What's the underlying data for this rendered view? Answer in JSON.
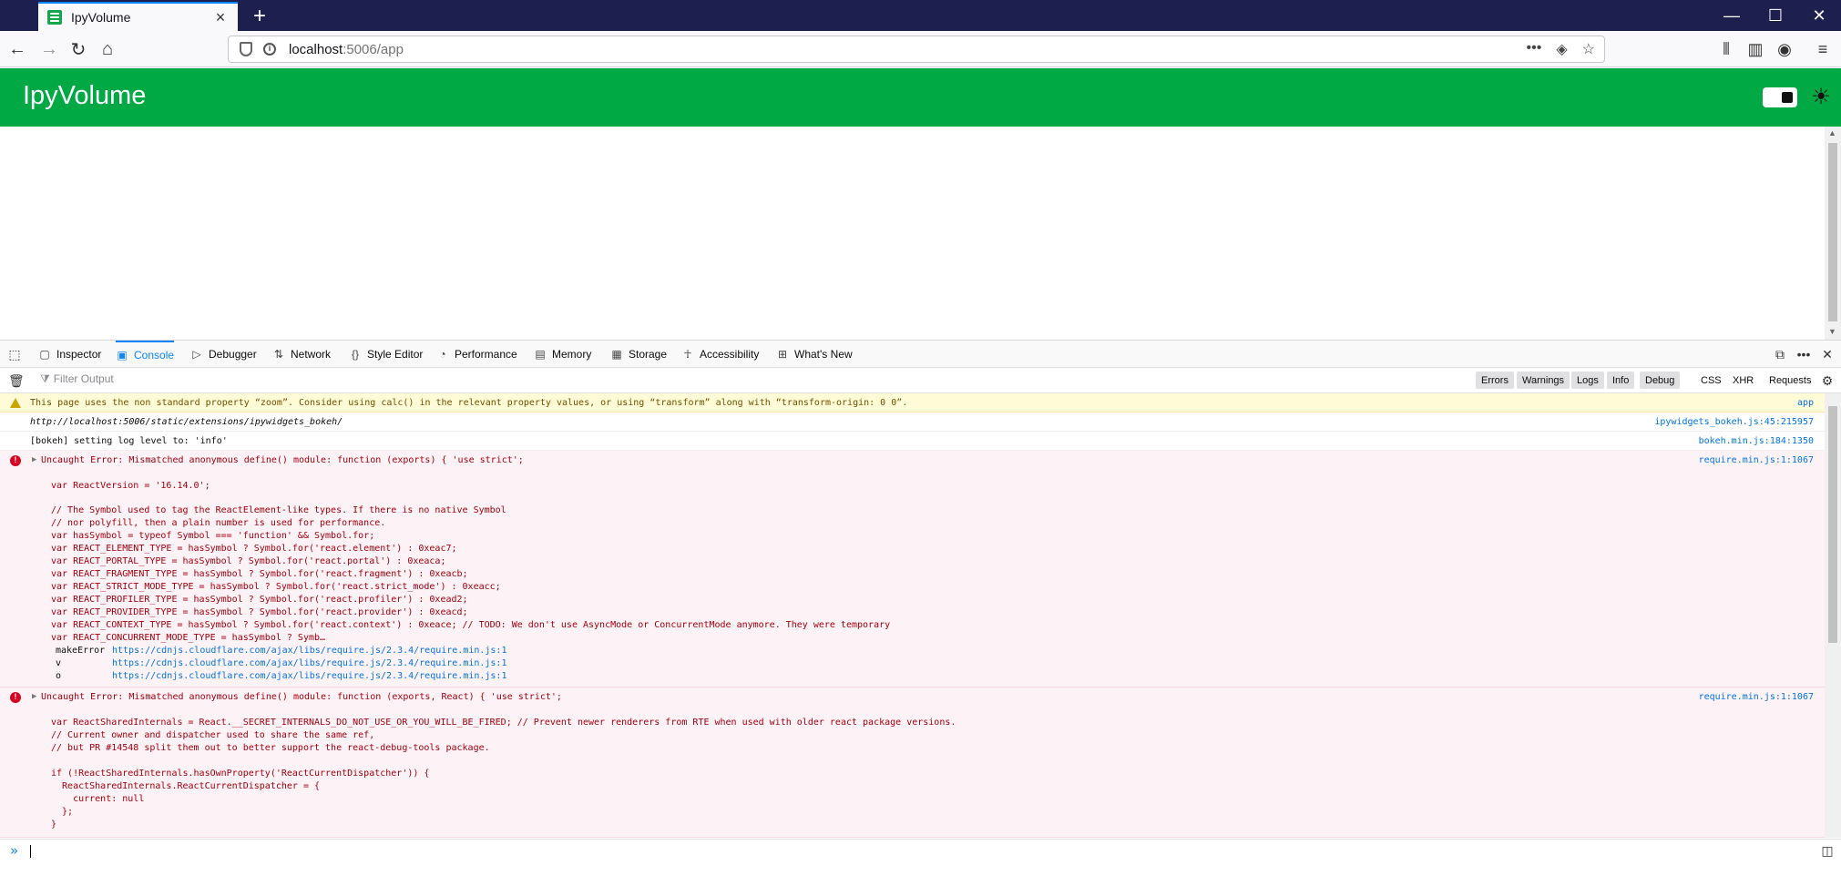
{
  "browser": {
    "tab_title": "IpyVolume",
    "url_host": "localhost",
    "url_path": ":5006/app"
  },
  "app": {
    "title": "IpyVolume"
  },
  "devtools": {
    "tabs": [
      "Inspector",
      "Console",
      "Debugger",
      "Network",
      "Style Editor",
      "Performance",
      "Memory",
      "Storage",
      "Accessibility",
      "What's New"
    ],
    "active_tab": "Console",
    "filter_placeholder": "Filter Output",
    "filters": [
      "Errors",
      "Warnings",
      "Logs",
      "Info",
      "Debug",
      "CSS",
      "XHR",
      "Requests"
    ]
  },
  "console": {
    "warning": {
      "text": "This page uses the non standard property “zoom”. Consider using calc() in the relevant property values, or using “transform” along with “transform-origin: 0 0”.",
      "source": "app"
    },
    "log1": {
      "text": "http://localhost:5006/static/extensions/ipywidgets_bokeh/",
      "source": "ipywidgets_bokeh.js:45:215957"
    },
    "log2": {
      "text": "[bokeh] setting log level to: 'info'",
      "source": "bokeh.min.js:184:1350"
    },
    "error1": {
      "head": "Uncaught Error: Mismatched anonymous define() module: function (exports) { 'use strict';",
      "source": "require.min.js:1:1067",
      "lines": [
        "var ReactVersion = '16.14.0';",
        "",
        "// The Symbol used to tag the ReactElement-like types. If there is no native Symbol",
        "// nor polyfill, then a plain number is used for performance.",
        "var hasSymbol = typeof Symbol === 'function' && Symbol.for;",
        "var REACT_ELEMENT_TYPE = hasSymbol ? Symbol.for('react.element') : 0xeac7;",
        "var REACT_PORTAL_TYPE = hasSymbol ? Symbol.for('react.portal') : 0xeaca;",
        "var REACT_FRAGMENT_TYPE = hasSymbol ? Symbol.for('react.fragment') : 0xeacb;",
        "var REACT_STRICT_MODE_TYPE = hasSymbol ? Symbol.for('react.strict_mode') : 0xeacc;",
        "var REACT_PROFILER_TYPE = hasSymbol ? Symbol.for('react.profiler') : 0xead2;",
        "var REACT_PROVIDER_TYPE = hasSymbol ? Symbol.for('react.provider') : 0xeacd;",
        "var REACT_CONTEXT_TYPE = hasSymbol ? Symbol.for('react.context') : 0xeace; // TODO: We don't use AsyncMode or ConcurrentMode anymore. They were temporary",
        "var REACT_CONCURRENT_MODE_TYPE = hasSymbol ? Symb…"
      ],
      "stack": [
        {
          "fn": "makeError",
          "url": "https://cdnjs.cloudflare.com/ajax/libs/require.js/2.3.4/require.min.js:1"
        },
        {
          "fn": "v",
          "url": "https://cdnjs.cloudflare.com/ajax/libs/require.js/2.3.4/require.min.js:1"
        },
        {
          "fn": "o",
          "url": "https://cdnjs.cloudflare.com/ajax/libs/require.js/2.3.4/require.min.js:1"
        }
      ]
    },
    "error2": {
      "head": "Uncaught Error: Mismatched anonymous define() module: function (exports, React) { 'use strict';",
      "source": "require.min.js:1:1067",
      "lines": [
        "var ReactSharedInternals = React.__SECRET_INTERNALS_DO_NOT_USE_OR_YOU_WILL_BE_FIRED; // Prevent newer renderers from RTE when used with older react package versions.",
        "// Current owner and dispatcher used to share the same ref,",
        "// but PR #14548 split them out to better support the react-debug-tools package.",
        "",
        "if (!ReactSharedInternals.hasOwnProperty('ReactCurrentDispatcher')) {",
        "  ReactSharedInternals.ReactCurrentDispatcher = {",
        "    current: null",
        "  };",
        "}"
      ]
    }
  }
}
